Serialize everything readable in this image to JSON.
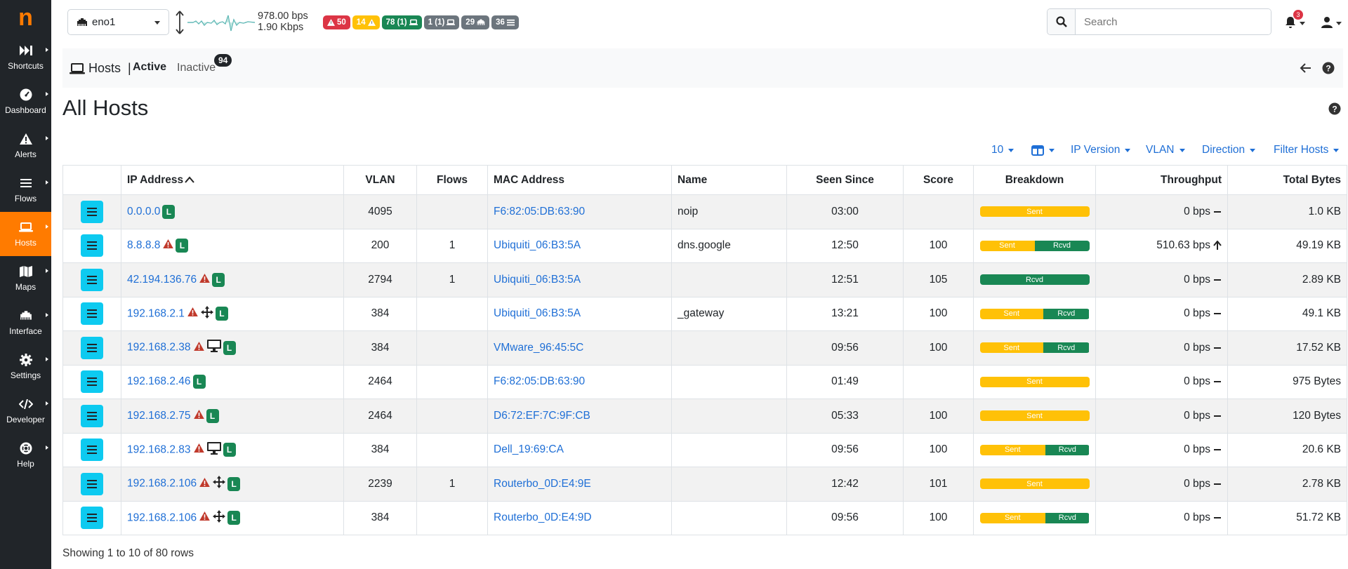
{
  "sidebar": {
    "logo": "n",
    "items": [
      {
        "label": "Shortcuts",
        "icon": "fast-forward-icon"
      },
      {
        "label": "Dashboard",
        "icon": "gauge-icon"
      },
      {
        "label": "Alerts",
        "icon": "warning-icon"
      },
      {
        "label": "Flows",
        "icon": "list-icon"
      },
      {
        "label": "Hosts",
        "icon": "laptop-icon",
        "active": true
      },
      {
        "label": "Maps",
        "icon": "map-icon"
      },
      {
        "label": "Interface",
        "icon": "ethernet-icon"
      },
      {
        "label": "Settings",
        "icon": "gear-icon"
      },
      {
        "label": "Developer",
        "icon": "code-icon"
      },
      {
        "label": "Help",
        "icon": "lifebuoy-icon"
      }
    ]
  },
  "topbar": {
    "interface": "eno1",
    "rate_up": "978.00 bps",
    "rate_down": "1.90 Kbps",
    "badges": [
      {
        "text": "50",
        "icon": "warning-icon",
        "color": "#dc3545"
      },
      {
        "text": "14",
        "icon": "warning-icon",
        "color": "#ffc107"
      },
      {
        "text": "78 (1)",
        "icon": "laptop-icon",
        "color": "#198754"
      },
      {
        "text": "1 (1)",
        "icon": "laptop-icon",
        "color": "#6c757d"
      },
      {
        "text": "29",
        "icon": "ethernet-icon",
        "color": "#6c757d"
      },
      {
        "text": "36",
        "icon": "list-icon",
        "color": "#6c757d"
      }
    ],
    "search_placeholder": "Search",
    "notifications": "3"
  },
  "subnav": {
    "title": "Hosts",
    "separator": "|",
    "active_tab": "Active",
    "inactive_tab": "Inactive",
    "inactive_count": "94"
  },
  "page_title": "All Hosts",
  "toolbar": {
    "page_size": "10",
    "ip_version": "IP Version",
    "vlan": "VLAN",
    "direction": "Direction",
    "filter_hosts": "Filter Hosts"
  },
  "table": {
    "columns": [
      "",
      "IP Address",
      "VLAN",
      "Flows",
      "MAC Address",
      "Name",
      "Seen Since",
      "Score",
      "Breakdown",
      "Throughput",
      "Total Bytes"
    ],
    "rows": [
      {
        "ip": "0.0.0.0",
        "alert": false,
        "device": "",
        "vlan": "4095",
        "flows": "",
        "mac": "F6:82:05:DB:63:90",
        "name": "noip",
        "seen": "03:00",
        "score": "",
        "sent": 1.0,
        "sent_label": "Sent",
        "rcvd_label": "",
        "throughput": "0 bps",
        "trend": "flat",
        "total": "1.0 KB"
      },
      {
        "ip": "8.8.8.8",
        "alert": true,
        "device": "",
        "vlan": "200",
        "flows": "1",
        "mac": "Ubiquiti_06:B3:5A",
        "name": "dns.google",
        "seen": "12:50",
        "score": "100",
        "sent": 0.5,
        "sent_label": "Sent",
        "rcvd_label": "Rcvd",
        "throughput": "510.63 bps",
        "trend": "up",
        "total": "49.19 KB"
      },
      {
        "ip": "42.194.136.76",
        "alert": true,
        "device": "",
        "vlan": "2794",
        "flows": "1",
        "mac": "Ubiquiti_06:B3:5A",
        "name": "",
        "seen": "12:51",
        "score": "105",
        "sent": 0.0,
        "sent_label": "",
        "rcvd_label": "Rcvd",
        "throughput": "0 bps",
        "trend": "flat",
        "total": "2.89 KB"
      },
      {
        "ip": "192.168.2.1",
        "alert": true,
        "device": "router",
        "vlan": "384",
        "flows": "",
        "mac": "Ubiquiti_06:B3:5A",
        "name": "_gateway",
        "seen": "13:21",
        "score": "100",
        "sent": 0.58,
        "sent_label": "Sent",
        "rcvd_label": "Rcvd",
        "throughput": "0 bps",
        "trend": "flat",
        "total": "49.1 KB"
      },
      {
        "ip": "192.168.2.38",
        "alert": true,
        "device": "desktop",
        "vlan": "384",
        "flows": "",
        "mac": "VMware_96:45:5C",
        "name": "",
        "seen": "09:56",
        "score": "100",
        "sent": 0.58,
        "sent_label": "Sent",
        "rcvd_label": "Rcvd",
        "throughput": "0 bps",
        "trend": "flat",
        "total": "17.52 KB"
      },
      {
        "ip": "192.168.2.46",
        "alert": false,
        "device": "",
        "vlan": "2464",
        "flows": "",
        "mac": "F6:82:05:DB:63:90",
        "name": "",
        "seen": "01:49",
        "score": "",
        "sent": 1.0,
        "sent_label": "Sent",
        "rcvd_label": "",
        "throughput": "0 bps",
        "trend": "flat",
        "total": "975 Bytes"
      },
      {
        "ip": "192.168.2.75",
        "alert": true,
        "device": "",
        "vlan": "2464",
        "flows": "",
        "mac": "D6:72:EF:7C:9F:CB",
        "name": "",
        "seen": "05:33",
        "score": "100",
        "sent": 1.0,
        "sent_label": "Sent",
        "rcvd_label": "",
        "throughput": "0 bps",
        "trend": "flat",
        "total": "120 Bytes"
      },
      {
        "ip": "192.168.2.83",
        "alert": true,
        "device": "desktop",
        "vlan": "384",
        "flows": "",
        "mac": "Dell_19:69:CA",
        "name": "",
        "seen": "09:56",
        "score": "100",
        "sent": 0.6,
        "sent_label": "Sent",
        "rcvd_label": "Rcvd",
        "throughput": "0 bps",
        "trend": "flat",
        "total": "20.6 KB"
      },
      {
        "ip": "192.168.2.106",
        "alert": true,
        "device": "router",
        "vlan": "2239",
        "flows": "1",
        "mac": "Routerbo_0D:E4:9E",
        "name": "",
        "seen": "12:42",
        "score": "101",
        "sent": 1.0,
        "sent_label": "Sent",
        "rcvd_label": "",
        "throughput": "0 bps",
        "trend": "flat",
        "total": "2.78 KB"
      },
      {
        "ip": "192.168.2.106",
        "alert": true,
        "device": "router",
        "vlan": "384",
        "flows": "",
        "mac": "Routerbo_0D:E4:9D",
        "name": "",
        "seen": "09:56",
        "score": "100",
        "sent": 0.6,
        "sent_label": "Sent",
        "rcvd_label": "Rcvd",
        "throughput": "0 bps",
        "trend": "flat",
        "total": "51.72 KB"
      }
    ]
  },
  "footer": "Showing 1 to 10 of 80 rows"
}
